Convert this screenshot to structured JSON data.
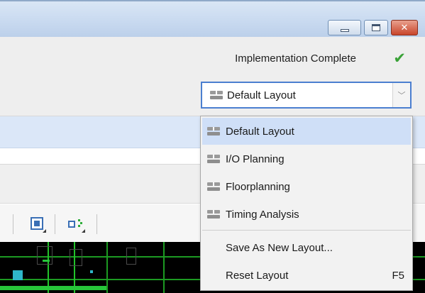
{
  "window": {
    "controls": [
      "minimize",
      "maximize",
      "close"
    ],
    "close_glyph": "✕"
  },
  "status": {
    "text": "Implementation Complete",
    "check_glyph": "✔",
    "check_color": "#3aa238"
  },
  "layout_selector": {
    "value": "Default Layout",
    "arrow_glyph": "﹀"
  },
  "layout_menu": {
    "items": [
      {
        "label": "Default Layout",
        "icon": "layout-icon",
        "selected": true
      },
      {
        "label": "I/O Planning",
        "icon": "layout-icon"
      },
      {
        "label": "Floorplanning",
        "icon": "layout-icon"
      },
      {
        "label": "Timing Analysis",
        "icon": "layout-icon"
      }
    ],
    "actions": [
      {
        "label": "Save As New Layout..."
      },
      {
        "label": "Reset Layout",
        "shortcut": "F5"
      }
    ]
  },
  "toolbar": {
    "buttons": [
      {
        "icon": "device-icon"
      },
      {
        "icon": "net-icon"
      }
    ]
  },
  "colors": {
    "accent_blue": "#4b7fd0",
    "selection": "#cfdff7",
    "device_green": "#22c32a"
  }
}
